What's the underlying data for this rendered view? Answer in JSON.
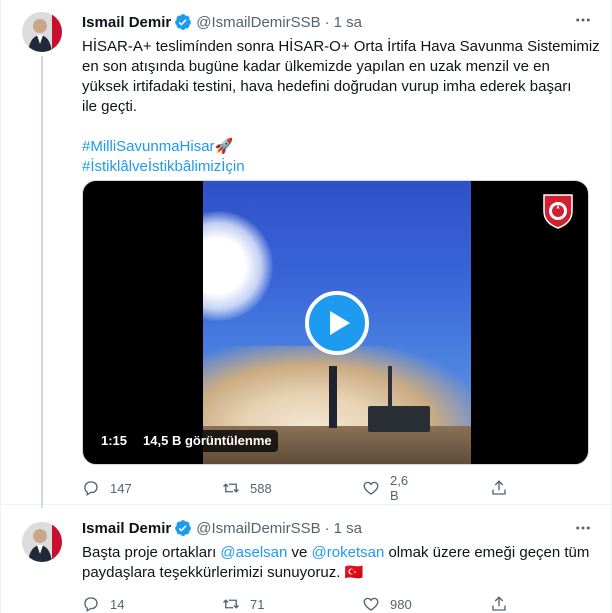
{
  "tweets": [
    {
      "author_name": "Ismail Demir",
      "handle": "@IsmailDemirSSB",
      "separator": "·",
      "time": "1 sa",
      "text_lines": [
        "HİSAR-A+ teslimínden sonra HİSAR-O+ Orta İrtifa Hava Savunma Sistemimiz",
        "en son atışında bugüne kadar ülkemizde yapılan en uzak menzil ve en",
        "yüksek irtifadaki testini, hava hedefini doğrudan vurup imha ederek başarı",
        "ile geçti."
      ],
      "hashtags": [
        "#MilliSavunmaHisar🚀",
        "#İstiklâlveİstikbâlimizİçin"
      ],
      "video": {
        "duration": "1:15",
        "views": "14,5 B görüntülenme"
      },
      "actions": {
        "replies": "147",
        "retweets": "588",
        "likes": "2,6 B"
      }
    },
    {
      "author_name": "Ismail Demir",
      "handle": "@IsmailDemirSSB",
      "separator": "·",
      "time": "1 sa",
      "text_parts": {
        "p1": "Başta proje ortakları ",
        "mention1": "@aselsan",
        "p2": " ve ",
        "mention2": "@roketsan",
        "p3": " olmak üzere emeği geçen tüm",
        "line2": "paydaşlara teşekkürlerimizi sunuyoruz. 🇹🇷"
      },
      "actions": {
        "replies": "14",
        "retweets": "71",
        "likes": "980"
      }
    }
  ],
  "colors": {
    "accent": "#1d9bf0",
    "muted": "#536471",
    "text": "#0f1419"
  }
}
